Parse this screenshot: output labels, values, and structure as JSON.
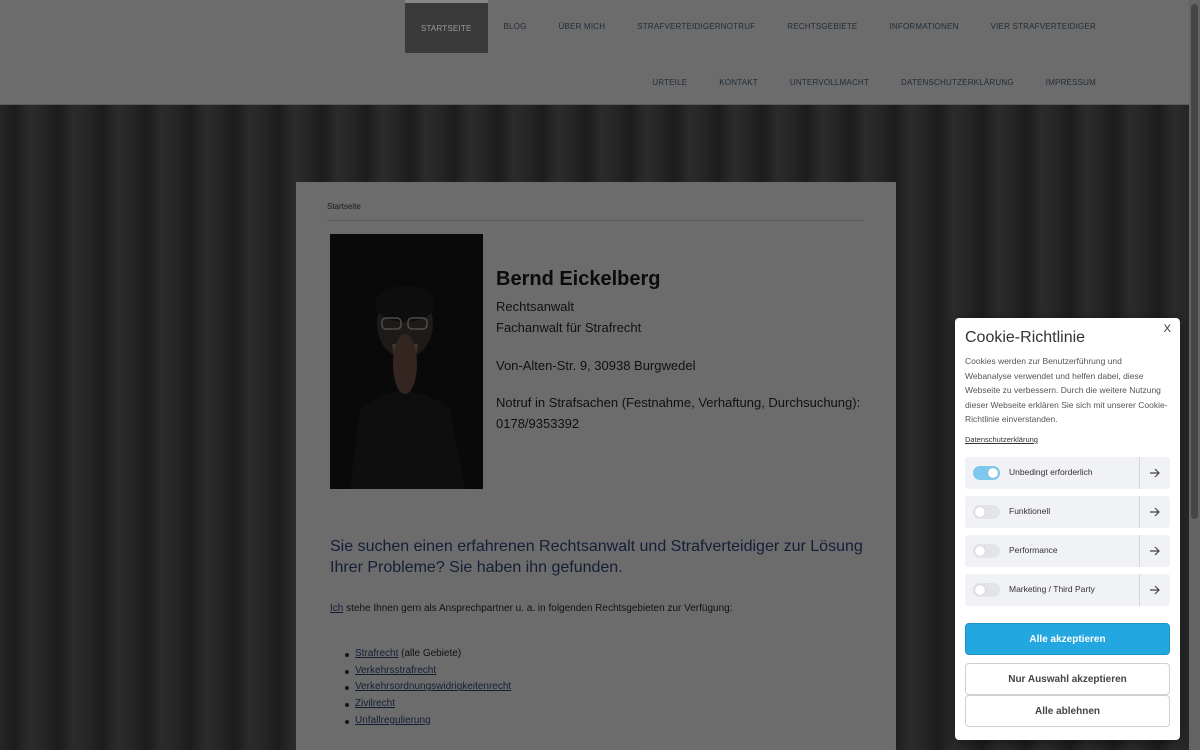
{
  "nav": {
    "row1": [
      "STARTSEITE",
      "BLOG",
      "ÜBER MICH",
      "STRAFVERTEIDIGERNOTRUF",
      "RECHTSGEBIETE",
      "INFORMATIONEN",
      "VIER STRAFVERTEIDIGER"
    ],
    "row2": [
      "URTEILE",
      "KONTAKT",
      "UNTERVOLLMACHT",
      "DATENSCHUTZERKLÄRUNG",
      "IMPRESSUM"
    ],
    "active": "STARTSEITE"
  },
  "breadcrumb": "Startseite",
  "profile": {
    "name": "Bernd Eickelberg",
    "title1": "Rechtsanwalt",
    "title2": "Fachanwalt für Strafrecht",
    "address": "Von-Alten-Str. 9, 30938 Burgwedel",
    "emergency": "Notruf in Strafsachen (Festnahme, Verhaftung, Durchsuchung):",
    "phone": "0178/9353392"
  },
  "headline": "Sie suchen einen erfahrenen Rechtsanwalt und Strafverteidiger zur Lösung Ihrer Probleme? Sie haben ihn gefunden.",
  "intro": {
    "link": "Ich",
    "text": " stehe Ihnen gern als Ansprechpartner u. a. in folgenden Rechtsgebieten zur Verfügung:"
  },
  "areas": [
    {
      "link": "Strafrecht",
      "suffix": " (alle Gebiete)"
    },
    {
      "link": "Verkehrsstrafrecht",
      "suffix": ""
    },
    {
      "link": "Verkehrsordnungswidrigkeitenrecht",
      "suffix": ""
    },
    {
      "link": "Zivilrecht",
      "suffix": ""
    },
    {
      "link": "Unfallregulierung",
      "suffix": ""
    }
  ],
  "cookie": {
    "close": "X",
    "title": "Cookie-Richtlinie",
    "text": "Cookies werden zur Benutzerführung und Webanalyse verwendet und helfen dabei, diese Webseite zu verbessern. Durch die weitere Nutzung dieser Webseite erklären Sie sich mit unserer Cookie-Richtlinie einverstanden.",
    "policy_link": "Datenschutzerklärung",
    "categories": [
      {
        "label": "Unbedingt erforderlich",
        "enabled": true
      },
      {
        "label": "Funktionell",
        "enabled": false
      },
      {
        "label": "Performance",
        "enabled": false
      },
      {
        "label": "Marketing / Third Party",
        "enabled": false
      }
    ],
    "accept_all": "Alle akzeptieren",
    "accept_selection": "Nur Auswahl akzeptieren",
    "reject_all": "Alle ablehnen"
  },
  "colors": {
    "accent": "#22a7e0",
    "toggle_on": "#7ec8ee",
    "headline": "#1f2f55"
  }
}
